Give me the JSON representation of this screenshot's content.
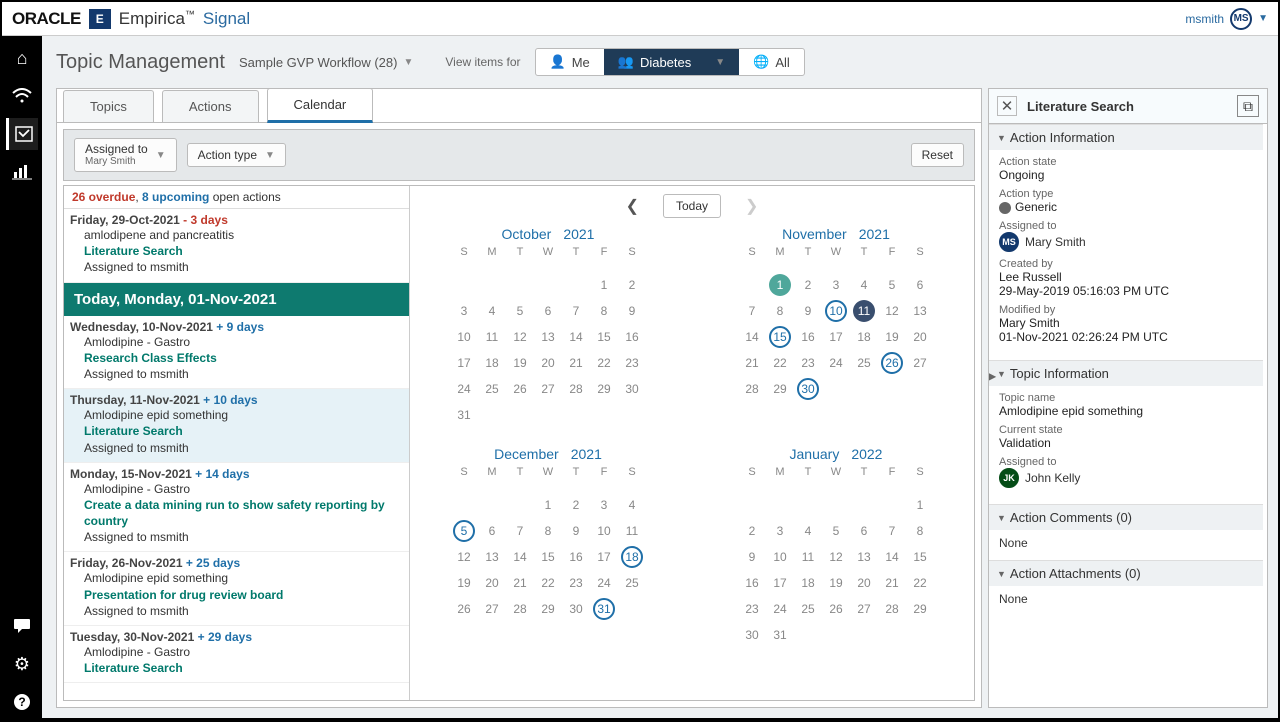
{
  "brand": {
    "oracle": "ORACLE",
    "product1": "Empirica",
    "product2": "Signal",
    "tm": "™"
  },
  "user": {
    "name": "msmith",
    "initials": "MS"
  },
  "page": {
    "title": "Topic Management",
    "workflow": "Sample GVP Workflow (28)",
    "view_label": "View items for"
  },
  "chips": {
    "me": "Me",
    "diabetes": "Diabetes",
    "all": "All"
  },
  "tabs": {
    "topics": "Topics",
    "actions": "Actions",
    "calendar": "Calendar"
  },
  "filter": {
    "assigned_label": "Assigned to",
    "assigned_value": "Mary Smith",
    "action_type": "Action type",
    "reset": "Reset"
  },
  "summary": {
    "overdue": "26 overdue",
    "sep": ", ",
    "upcoming": "8 upcoming",
    "tail": " open actions"
  },
  "today_bar": "Today, Monday, 01-Nov-2021",
  "calnav": {
    "today": "Today"
  },
  "dayheaders": [
    "S",
    "M",
    "T",
    "W",
    "T",
    "F",
    "S"
  ],
  "months": [
    {
      "name": "October",
      "year": "2021",
      "offset": 5,
      "days": 31,
      "today": null,
      "selected": null,
      "events": []
    },
    {
      "name": "November",
      "year": "2021",
      "offset": 1,
      "days": 30,
      "today": 1,
      "selected": 11,
      "events": [
        10,
        15,
        26,
        30
      ]
    },
    {
      "name": "December",
      "year": "2021",
      "offset": 3,
      "days": 31,
      "today": null,
      "selected": null,
      "events": [
        5,
        18,
        31
      ]
    },
    {
      "name": "January",
      "year": "2022",
      "offset": 6,
      "days": 31,
      "today": null,
      "selected": null,
      "events": []
    }
  ],
  "blocks": [
    {
      "date": "Friday, 29-Oct-2021",
      "delta": "- 3 days",
      "deltaClass": "delta-red",
      "lines": [
        "amlodipene and pancreatitis",
        "Literature Search",
        "Assigned to msmith"
      ],
      "links": [
        1
      ]
    },
    {
      "date": "Wednesday, 10-Nov-2021",
      "delta": "+ 9 days",
      "deltaClass": "delta-blue",
      "lines": [
        "Amlodipine - Gastro",
        "Research Class Effects",
        "Assigned to msmith"
      ],
      "links": [
        1
      ]
    },
    {
      "date": "Thursday, 11-Nov-2021",
      "delta": "+ 10 days",
      "deltaClass": "delta-blue",
      "selected": true,
      "lines": [
        "Amlodipine epid something",
        "Literature Search",
        "Assigned to msmith"
      ],
      "links": [
        1
      ]
    },
    {
      "date": "Monday, 15-Nov-2021",
      "delta": "+ 14 days",
      "deltaClass": "delta-blue",
      "lines": [
        "Amlodipine - Gastro",
        "Create a data mining run to show safety reporting by country",
        "Assigned to msmith"
      ],
      "links": [
        1
      ]
    },
    {
      "date": "Friday, 26-Nov-2021",
      "delta": "+ 25 days",
      "deltaClass": "delta-blue",
      "lines": [
        "Amlodipine epid something",
        "Presentation for drug review board",
        "Assigned to msmith"
      ],
      "links": [
        1
      ]
    },
    {
      "date": "Tuesday, 30-Nov-2021",
      "delta": "+ 29 days",
      "deltaClass": "delta-blue",
      "lines": [
        "Amlodipine - Gastro",
        "Literature Search"
      ],
      "links": [
        1
      ]
    }
  ],
  "side": {
    "title": "Literature Search",
    "sections": {
      "action_info": "Action Information",
      "topic_info": "Topic Information",
      "comments": "Action Comments (0)",
      "attachments": "Action Attachments (0)"
    },
    "action_state_lab": "Action state",
    "action_state": "Ongoing",
    "action_type_lab": "Action type",
    "action_type": "Generic",
    "assigned_lab": "Assigned to",
    "assigned_name": "Mary Smith",
    "assigned_initials": "MS",
    "created_lab": "Created by",
    "created_name": "Lee Russell",
    "created_ts": "29-May-2019 05:16:03 PM UTC",
    "modified_lab": "Modified by",
    "modified_name": "Mary Smith",
    "modified_ts": "01-Nov-2021 02:26:24 PM UTC",
    "topic_name_lab": "Topic name",
    "topic_name": "Amlodipine epid something",
    "current_state_lab": "Current state",
    "current_state": "Validation",
    "topic_assigned_lab": "Assigned to",
    "topic_assigned_name": "John Kelly",
    "topic_assigned_initials": "JK",
    "none": "None"
  }
}
